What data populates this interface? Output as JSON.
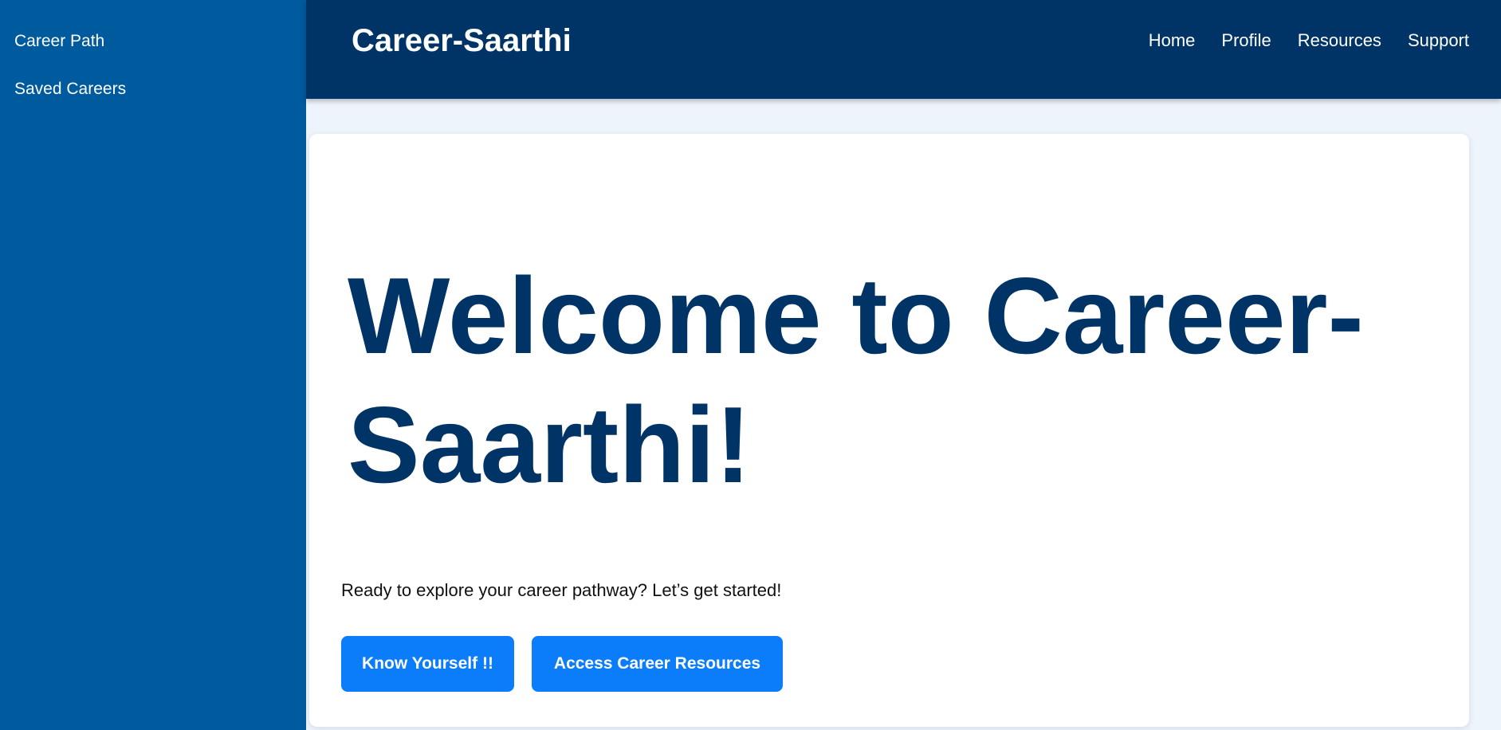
{
  "sidebar": {
    "items": [
      {
        "label": "Career Path"
      },
      {
        "label": "Saved Careers"
      }
    ]
  },
  "header": {
    "brand": "Career-Saarthi",
    "nav": [
      {
        "label": "Home"
      },
      {
        "label": "Profile"
      },
      {
        "label": "Resources"
      },
      {
        "label": "Support"
      }
    ]
  },
  "main": {
    "title": "Welcome to Career-Saarthi!",
    "subtitle": "Ready to explore your career pathway? Let’s get started!",
    "buttons": {
      "know_yourself": "Know Yourself !!",
      "career_resources": "Access Career Resources"
    }
  },
  "colors": {
    "sidebar_bg": "#005a9e",
    "header_bg": "#003366",
    "title": "#003366",
    "button_bg": "#0b7dfa",
    "page_bg": "#eef4fb"
  }
}
